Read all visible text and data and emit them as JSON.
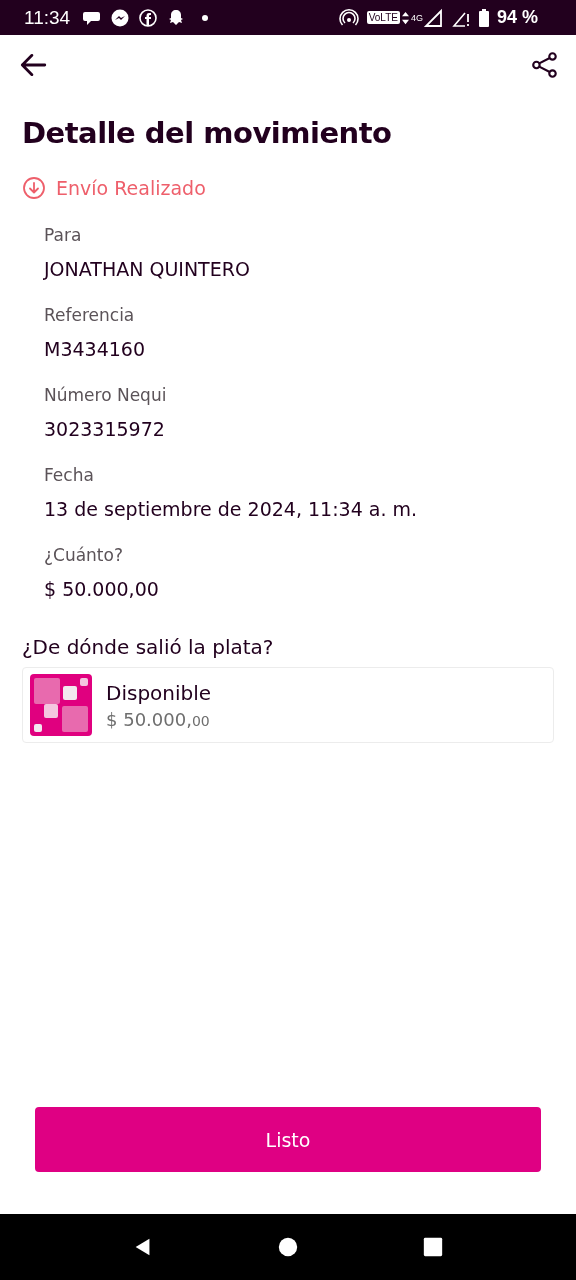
{
  "status_bar": {
    "time": "11:34",
    "volte": "VoLTE",
    "network": "4G",
    "battery": "94 %"
  },
  "title": "Detalle del movimiento",
  "status": {
    "label": "Envío Realizado"
  },
  "fields": [
    {
      "label": "Para",
      "value": "JONATHAN QUINTERO"
    },
    {
      "label": "Referencia",
      "value": "M3434160"
    },
    {
      "label": "Número Nequi",
      "value": "3023315972"
    },
    {
      "label": "Fecha",
      "value": "13 de septiembre de 2024, 11:34 a. m."
    },
    {
      "label": "¿Cuánto?",
      "value": "$ 50.000,00"
    }
  ],
  "source": {
    "heading": "¿De dónde salió la plata?",
    "account": {
      "name": "Disponible",
      "amount": "$ 50.000,",
      "cents": "00"
    }
  },
  "button": "Listo"
}
